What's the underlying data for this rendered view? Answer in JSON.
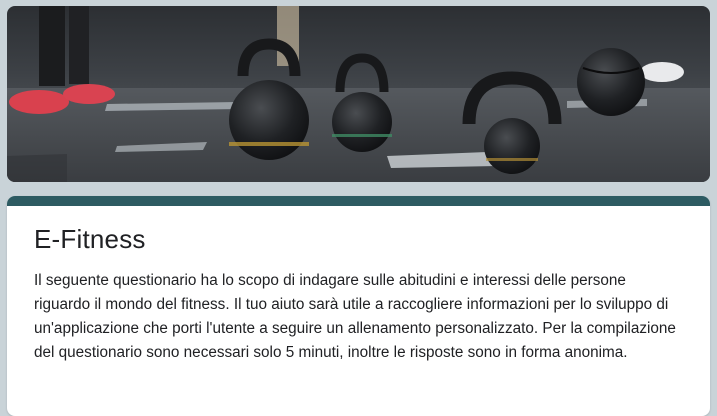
{
  "form": {
    "title": "E-Fitness",
    "description": "Il seguente questionario ha lo scopo di indagare sulle abitudini e interessi delle persone riguardo il mondo del fitness. Il tuo aiuto sarà utile a raccogliere informazioni per lo sviluppo di un'applicazione che porti l'utente a seguire un allenamento personalizzato. Per la compilazione del questionario sono necessari solo 5 minuti, inoltre le risposte sono in forma anonima."
  },
  "theme": {
    "accent": "#2d5b62",
    "background": "#c9d3d8"
  }
}
